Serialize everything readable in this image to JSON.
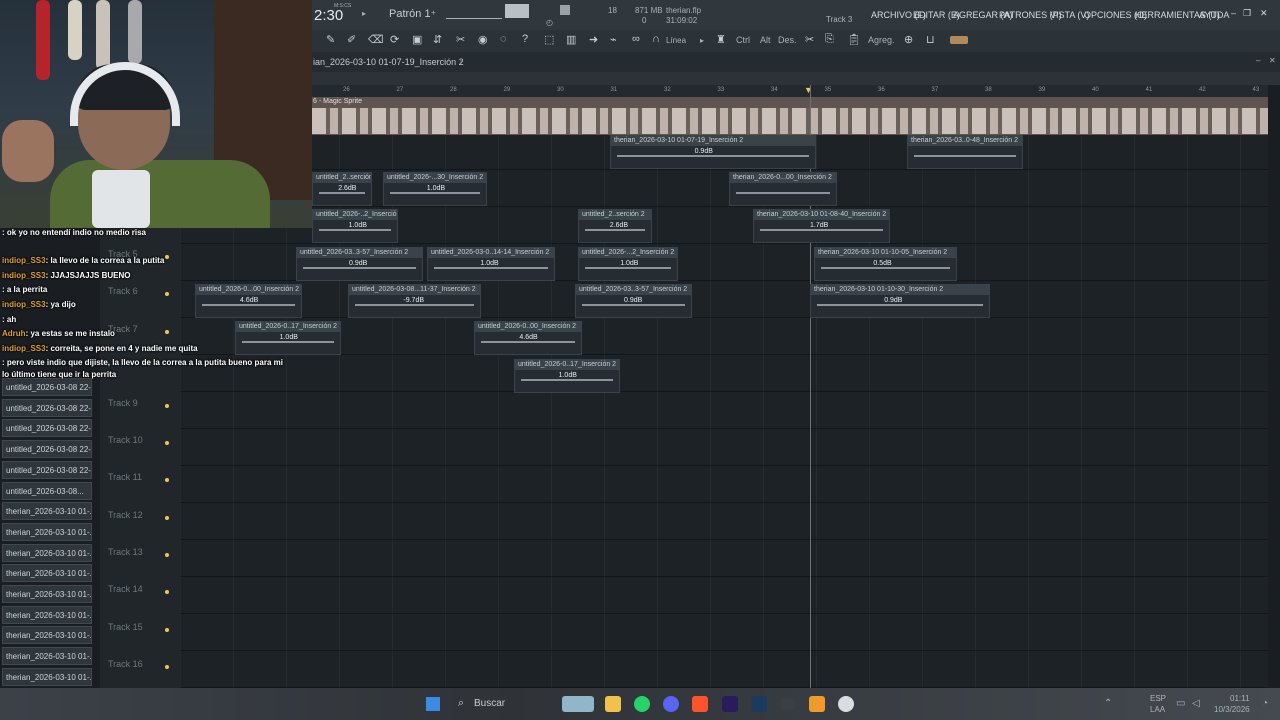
{
  "topbar": {
    "time": "2:30",
    "time_unit": "M:S:CS",
    "pattern": "Patrón 1",
    "cpu": "18",
    "memory": "871 MB",
    "polyphony": "0",
    "file_name": "therian.flp",
    "file_time": "31:09:02",
    "track_hint": "Track 3",
    "menu": [
      "ARCHIVO (F)",
      "EDITAR (E)",
      "AGREGAR (A)",
      "PATRONES (P)",
      "VISTA (V)",
      "OPCIONES (O)",
      "HERRAMIENTAS (T)",
      "AYUDA"
    ]
  },
  "toolbar": {
    "snap": "Línea",
    "ctrl": "Ctrl",
    "alt": "Alt",
    "des": "Des.",
    "agreg": "Agreg."
  },
  "playlist": {
    "breadcrumb": "ian_2026-03-10 01-07-19_Inserción 2",
    "magic_track": "6 - Magic Sprite",
    "ruler": [
      "26",
      "27",
      "28",
      "29",
      "30",
      "31",
      "32",
      "33",
      "34",
      "35",
      "36",
      "37",
      "38",
      "39",
      "40",
      "41",
      "42",
      "43"
    ],
    "tracks": [
      "Track 5",
      "Track 6",
      "Track 7",
      "Track 9",
      "Track 10",
      "Track 11",
      "Track 12",
      "Track 13",
      "Track 14",
      "Track 15",
      "Track 16"
    ],
    "clips": [
      {
        "name": "therian_2026-03-10 01-07-19_Inserción 2",
        "db": "0.9dB"
      },
      {
        "name": "therian_2026-03..0-48_Inserción 2",
        "db": ""
      },
      {
        "name": "untitled_2..serción 2",
        "db": "2.6dB"
      },
      {
        "name": "untitled_2026-...30_Inserción 2",
        "db": "1.0dB"
      },
      {
        "name": "therian_2026-0...00_Inserción 2",
        "db": ""
      },
      {
        "name": "untitled_2026-..2_Inserción 2",
        "db": "1.0dB"
      },
      {
        "name": "untitled_2..serción 2",
        "db": "2.6dB"
      },
      {
        "name": "therian_2026-03-10 01-08-40_Inserción 2",
        "db": "1.7dB"
      },
      {
        "name": "untitled_2026-03..3-57_Inserción 2",
        "db": "0.9dB"
      },
      {
        "name": "untitled_2026-03-0..14-14_Inserción 2",
        "db": "1.0dB"
      },
      {
        "name": "untitled_2026-...2_Inserción 2",
        "db": "1.0dB"
      },
      {
        "name": "therian_2026-03-10 01-10-05_Inserción 2",
        "db": "0.5dB"
      },
      {
        "name": "untitled_2026-0...00_Inserción 2",
        "db": "4.6dB"
      },
      {
        "name": "untitled_2026-03-08...11-37_Inserción 2",
        "db": "-9.7dB"
      },
      {
        "name": "untitled_2026-03..3-57_Inserción 2",
        "db": "0.9dB"
      },
      {
        "name": "therian_2026-03-10 01-10-30_Inserción 2",
        "db": "0.9dB"
      },
      {
        "name": "untitled_2026-0..17_Inserción 2",
        "db": "1.0dB"
      },
      {
        "name": "untitled_2026-0..00_Inserción 2",
        "db": "4.6dB"
      },
      {
        "name": "untitled_2026-0..17_Inserción 2",
        "db": "1.0dB"
      }
    ]
  },
  "picker": [
    "untitled_2026-03-08 22-...",
    "untitled_2026-03-08 22-...",
    "untitled_2026-03-08 22-...",
    "untitled_2026-03-08 22-...",
    "untitled_2026-03-08 22-...",
    "untitled_2026-03-08...",
    "therian_2026-03-10 01-...",
    "therian_2026-03-10 01-...",
    "therian_2026-03-10 01-...",
    "therian_2026-03-10 01-...",
    "therian_2026-03-10 01-...",
    "therian_2026-03-10 01-...",
    "therian_2026-03-10 01-...",
    "therian_2026-03-10 01-...",
    "therian_2026-03-10 01-..."
  ],
  "chat": [
    {
      "user": "",
      "text": ": ok yo no entendí indio no medio risa"
    },
    {
      "user": "indiop_SS3",
      "text": ": la llevo de la correa a la putita"
    },
    {
      "user": "indiop_SS3",
      "text": ": JJAJSJAJJS BUENO"
    },
    {
      "user": "",
      "text": ": a la perrita"
    },
    {
      "user": "indiop_SS3",
      "text": ": ya dijo"
    },
    {
      "user": "",
      "text": ": ah"
    },
    {
      "user": "Adruh",
      "text": ": ya estas se me instalo"
    },
    {
      "user": "indiop_SS3",
      "text": ": correita, se pone en 4 y nadie me quita"
    },
    {
      "user": "",
      "text": ": pero viste indio que dijiste, la llevo de la correa a la putita bueno para mi"
    },
    {
      "user": "",
      "text": "lo último tiene que ir la perrita"
    }
  ],
  "taskbar": {
    "search": "Buscar",
    "lang1": "ESP",
    "lang2": "LAA",
    "time": "01:11",
    "date": "10/3/2026"
  },
  "colors": {
    "accent": "#f3c54e",
    "playlist_bg": "#1d2226",
    "magic_clip": "#5e5450"
  }
}
